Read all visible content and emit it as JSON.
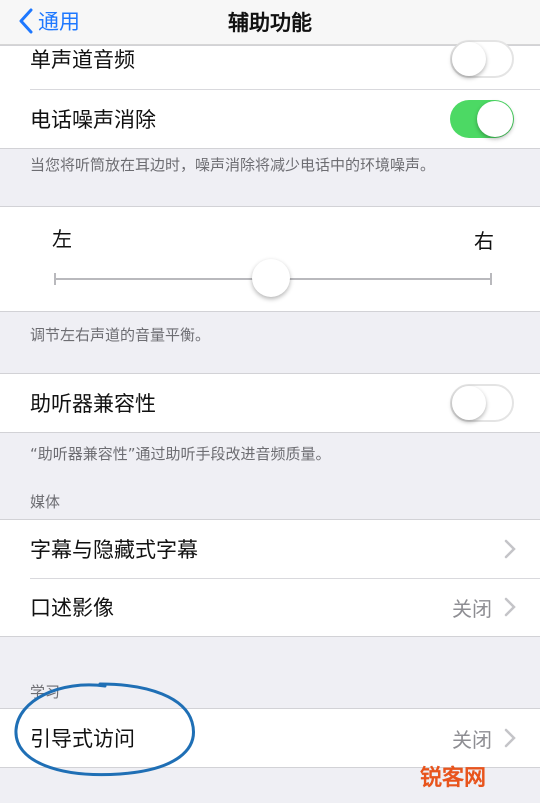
{
  "nav": {
    "back_label": "通用",
    "title": "辅助功能"
  },
  "audio": {
    "mono_label": "单声道音频",
    "mono_on": false,
    "noise_label": "电话噪声消除",
    "noise_on": true,
    "noise_footer": "当您将听筒放在耳边时，噪声消除将减少电话中的环境噪声。"
  },
  "balance": {
    "left_label": "左",
    "right_label": "右",
    "value": 0.5,
    "footer": "调节左右声道的音量平衡。"
  },
  "hearing": {
    "label": "助听器兼容性",
    "on": false,
    "footer": "“助听器兼容性”通过助听手段改进音频质量。"
  },
  "media": {
    "header": "媒体",
    "subtitles_label": "字幕与隐藏式字幕",
    "audio_desc_label": "口述影像",
    "audio_desc_value": "关闭"
  },
  "learning": {
    "header": "学习",
    "guided_label": "引导式访问",
    "guided_value": "关闭"
  },
  "watermark": {
    "text": "锐客网"
  },
  "colors": {
    "accent": "#1e78ff",
    "toggle_on": "#4cd964",
    "annotation": "#1f6fb5",
    "watermark": "#e8541c"
  }
}
